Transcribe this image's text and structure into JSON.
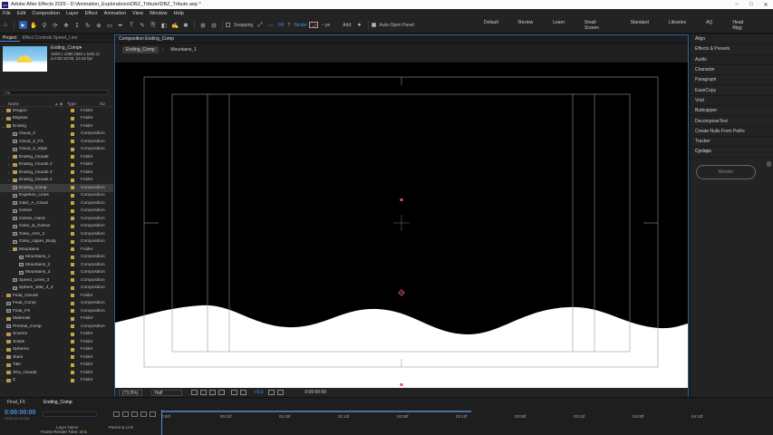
{
  "window": {
    "title": "Adobe After Effects 2025 - D:\\Animation_Explorations\\DBZ_Tribute\\DBZ_Tribute.aep *",
    "app_badge": "Ae",
    "controls": [
      "–",
      "□",
      "✕"
    ]
  },
  "menu": [
    "File",
    "Edit",
    "Composition",
    "Layer",
    "Effect",
    "Animation",
    "View",
    "Window",
    "Help"
  ],
  "toolbar": {
    "snapping_label": "Snapping",
    "fill_label": "Fill",
    "fill_help": "?",
    "stroke_label": "Stroke",
    "stroke_unit": "– px",
    "add_label": "Add:",
    "auto_open_label": "Auto-Open Panel",
    "workspaces": [
      "Default",
      "Review",
      "Learn",
      "Small Screen",
      "Standard",
      "Libraries",
      "AQ",
      "Head Rigg"
    ]
  },
  "project_panel": {
    "tab_project": "Project",
    "tab_effect_controls": "Effect Controls Speed_Line",
    "comp_name": "Ending_Comp▾",
    "comp_info_1": "1920 x 1080 (960 x 540) (1.",
    "comp_info_2": "Δ 0:00:10:00, 24.00 fps",
    "search_placeholder": "Ρ▾",
    "col_name": "Name",
    "col_type": "Type",
    "col_size": "Siz",
    "items": [
      {
        "name": "Dragon",
        "type": "Folder",
        "kind": "folder",
        "indent": 0,
        "tri": "›"
      },
      {
        "name": "Ellipses",
        "type": "Folder",
        "kind": "folder",
        "indent": 0,
        "tri": "›"
      },
      {
        "name": "Ending",
        "type": "Folder",
        "kind": "folder",
        "indent": 0,
        "tri": "⌄"
      },
      {
        "name": "Cloud_2",
        "type": "Composition",
        "kind": "comp",
        "indent": 1,
        "tri": ""
      },
      {
        "name": "Cloud_2_FX",
        "type": "Composition",
        "kind": "comp",
        "indent": 1,
        "tri": ""
      },
      {
        "name": "Cloud_2_Style",
        "type": "Composition",
        "kind": "comp",
        "indent": 1,
        "tri": ""
      },
      {
        "name": "Ending_Clouds",
        "type": "Folder",
        "kind": "folder",
        "indent": 1,
        "tri": "›"
      },
      {
        "name": "Ending_Clouds 2",
        "type": "Folder",
        "kind": "folder",
        "indent": 1,
        "tri": "›"
      },
      {
        "name": "Ending_Clouds 3",
        "type": "Folder",
        "kind": "folder",
        "indent": 1,
        "tri": "›"
      },
      {
        "name": "Ending_Clouds 4",
        "type": "Folder",
        "kind": "folder",
        "indent": 1,
        "tri": "›"
      },
      {
        "name": "Ending_Comp",
        "type": "Composition",
        "kind": "comp",
        "indent": 1,
        "tri": "",
        "selected": true
      },
      {
        "name": "Expetion_Lines",
        "type": "Composition",
        "kind": "comp",
        "indent": 1,
        "tri": ""
      },
      {
        "name": "G&G_A_Cloud",
        "type": "Composition",
        "kind": "comp",
        "indent": 1,
        "tri": ""
      },
      {
        "name": "Gohan",
        "type": "Composition",
        "kind": "comp",
        "indent": 1,
        "tri": ""
      },
      {
        "name": "Gohan_Hand",
        "type": "Composition",
        "kind": "comp",
        "indent": 1,
        "tri": ""
      },
      {
        "name": "Goku_&_Gohan",
        "type": "Composition",
        "kind": "comp",
        "indent": 1,
        "tri": ""
      },
      {
        "name": "Goku_Arm_2",
        "type": "Composition",
        "kind": "comp",
        "indent": 1,
        "tri": ""
      },
      {
        "name": "Goku_Upper_Body",
        "type": "Composition",
        "kind": "comp",
        "indent": 1,
        "tri": ""
      },
      {
        "name": "Mountains",
        "type": "Folder",
        "kind": "folder",
        "indent": 1,
        "tri": "⌄"
      },
      {
        "name": "Mountains_1",
        "type": "Composition",
        "kind": "comp",
        "indent": 2,
        "tri": ""
      },
      {
        "name": "Mountains_2",
        "type": "Composition",
        "kind": "comp",
        "indent": 2,
        "tri": ""
      },
      {
        "name": "Mountains_3",
        "type": "Composition",
        "kind": "comp",
        "indent": 2,
        "tri": ""
      },
      {
        "name": "Speed_Lines_3",
        "type": "Composition",
        "kind": "comp",
        "indent": 1,
        "tri": ""
      },
      {
        "name": "Sphere_Star_4_2",
        "type": "Composition",
        "kind": "comp",
        "indent": 1,
        "tri": ""
      },
      {
        "name": "Final_Clouds",
        "type": "Folder",
        "kind": "folder",
        "indent": 0,
        "tri": "›"
      },
      {
        "name": "Final_Comp",
        "type": "Composition",
        "kind": "comp",
        "indent": 0,
        "tri": ""
      },
      {
        "name": "Final_FX",
        "type": "Composition",
        "kind": "comp",
        "indent": 0,
        "tri": ""
      },
      {
        "name": "Materials",
        "type": "Folder",
        "kind": "folder",
        "indent": 0,
        "tri": "›"
      },
      {
        "name": "Prefinal_Comp",
        "type": "Composition",
        "kind": "comp",
        "indent": 0,
        "tri": ""
      },
      {
        "name": "Sceens",
        "type": "Folder",
        "kind": "folder",
        "indent": 0,
        "tri": "›"
      },
      {
        "name": "Solids",
        "type": "Folder",
        "kind": "folder",
        "indent": 0,
        "tri": "›"
      },
      {
        "name": "Spheres",
        "type": "Folder",
        "kind": "folder",
        "indent": 0,
        "tri": "›"
      },
      {
        "name": "Stars",
        "type": "Folder",
        "kind": "folder",
        "indent": 0,
        "tri": "›"
      },
      {
        "name": "Title",
        "type": "Folder",
        "kind": "folder",
        "indent": 0,
        "tri": "›"
      },
      {
        "name": "Xtra_Clouds",
        "type": "Folder",
        "kind": "folder",
        "indent": 0,
        "tri": "›"
      },
      {
        "name": "Z",
        "type": "Folder",
        "kind": "folder",
        "indent": 0,
        "tri": "›"
      }
    ],
    "bpc": "8 bpc"
  },
  "comp_panel": {
    "tab_label": "Composition Ending_Comp",
    "breadcrumbs": [
      "Ending_Comp",
      "Mountains_1"
    ],
    "zoom": "(73,9%)",
    "resolution": "Half",
    "exposure": "+0,0",
    "timecode": "0:00:00:00"
  },
  "right_panel": {
    "items": [
      "Align",
      "Effects & Presets",
      "Audio",
      "Character",
      "Paragraph",
      "EaseCopy",
      "Void",
      "Buttcapper",
      "DecomposeText",
      "Create Nulls From Paths",
      "Tracker",
      "Cyclops"
    ],
    "render_label": "Render"
  },
  "timeline": {
    "tabs": [
      "Final_FX",
      "Ending_Comp"
    ],
    "current_time": "0:00:00:00",
    "time_sub": "00000 (24.00 fps)",
    "ruler": [
      "0:00f",
      "00:12f",
      "01:00f",
      "01:12f",
      "02:00f",
      "02:12f",
      "03:00f",
      "03:12f",
      "04:00f",
      "04:12f"
    ],
    "layer_name_col": "Layer Name",
    "parent_col": "Parent & Link",
    "render_time_label": "Frame Render Time:",
    "render_time_value": "2ms"
  },
  "colors": {
    "accent_blue": "#4a8fe0",
    "folder_label": "#c9a83a",
    "anchor_pink": "#e0507a",
    "panel_bg": "#232323"
  }
}
